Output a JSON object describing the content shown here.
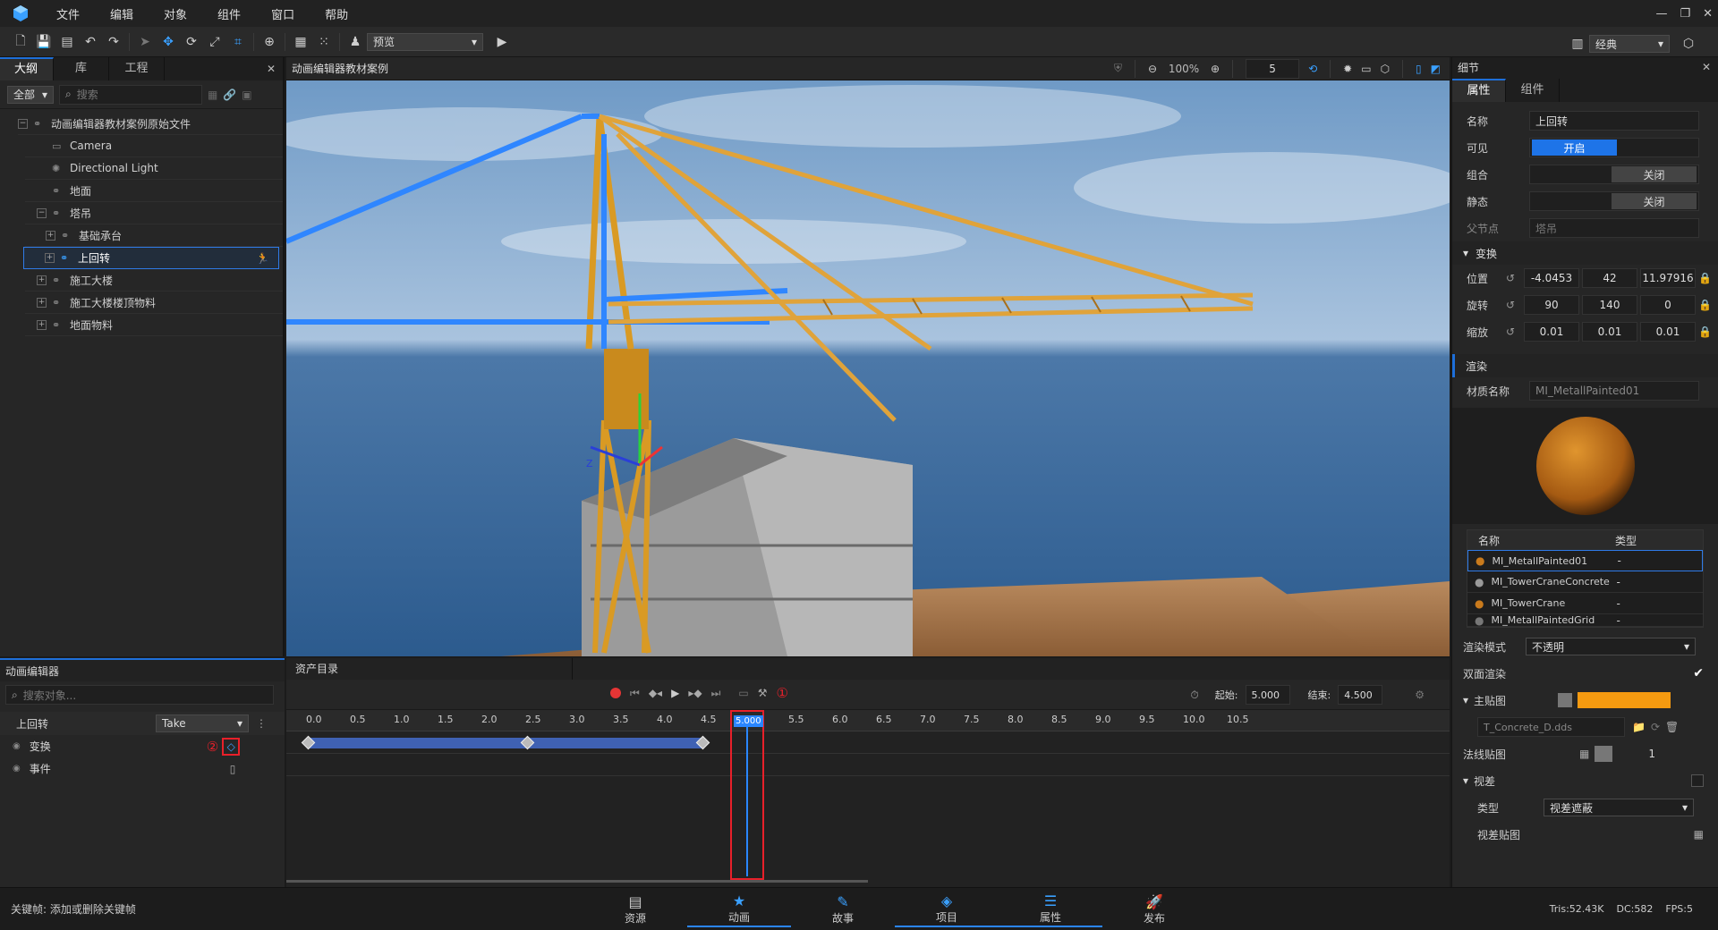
{
  "menu": [
    "文件",
    "编辑",
    "对象",
    "组件",
    "窗口",
    "帮助"
  ],
  "toolbar": {
    "preview_label": "预览",
    "layout_label": "经典"
  },
  "colors": {
    "accent": "#1e6fd9",
    "highlight": "#2a86ff",
    "record": "#e63535",
    "orange": "#f5a623",
    "track": "#3f61b3",
    "red_box": "#e8202a"
  },
  "outline": {
    "tabs": [
      "大纲",
      "库",
      "工程"
    ],
    "filter": "全部",
    "search_placeholder": "搜索",
    "items": [
      {
        "label": "动画编辑器教材案例原始文件",
        "icon": "object-icon"
      },
      {
        "label": "Camera",
        "icon": "camera-icon"
      },
      {
        "label": "Directional Light",
        "icon": "light-icon"
      },
      {
        "label": "地面",
        "icon": "object-icon"
      },
      {
        "label": "塔吊",
        "icon": "object-icon"
      },
      {
        "label": "基础承台",
        "icon": "object-icon"
      },
      {
        "label": "上回转",
        "icon": "object-icon"
      },
      {
        "label": "施工大楼",
        "icon": "object-icon"
      },
      {
        "label": "施工大楼楼顶物料",
        "icon": "object-icon"
      },
      {
        "label": "地面物料",
        "icon": "object-icon"
      }
    ]
  },
  "viewport": {
    "title": "动画编辑器教材案例",
    "zoom": "100%",
    "speed": "5",
    "axis_label": "Z"
  },
  "details": {
    "title": "细节",
    "tabs": [
      "属性",
      "组件"
    ],
    "name_label": "名称",
    "name_value": "上回转",
    "visible_label": "可见",
    "visible_value": "开启",
    "group_label": "组合",
    "group_value": "关闭",
    "static_label": "静态",
    "static_value": "关闭",
    "parent_label": "父节点",
    "parent_value": "塔吊",
    "transform_section": "变换",
    "position_label": "位置",
    "position": [
      "-4.0453",
      "42",
      "11.97916"
    ],
    "rotation_label": "旋转",
    "rotation": [
      "90",
      "140",
      "0"
    ],
    "scale_label": "缩放",
    "scale": [
      "0.01",
      "0.01",
      "0.01"
    ],
    "render_section": "渲染",
    "material_name_label": "材质名称",
    "material_name_value": "MI_MetallPainted01",
    "mat_table_headers": [
      "名称",
      "类型"
    ],
    "materials": [
      {
        "name": "MI_MetallPainted01",
        "type": "-"
      },
      {
        "name": "MI_TowerCraneConcrete",
        "type": "-"
      },
      {
        "name": "MI_TowerCrane",
        "type": "-"
      },
      {
        "name": "MI_MetallPaintedGrid",
        "type": "-"
      }
    ],
    "render_mode_label": "渲染模式",
    "render_mode_value": "不透明",
    "double_side_label": "双面渲染",
    "main_tex_label": "主贴图",
    "main_tex_file": "T_Concrete_D.dds",
    "normal_tex_label": "法线贴图",
    "normal_value": "1",
    "parallax_label": "视差",
    "parallax_type_label": "类型",
    "parallax_type_value": "视差遮蔽",
    "parallax_tex_label": "视差贴图"
  },
  "anim_editor": {
    "title": "动画编辑器",
    "search_placeholder": "搜索对象...",
    "object_name": "上回转",
    "take": "Take",
    "tracks": [
      "变换",
      "事件"
    ],
    "marker1": "①",
    "marker2": "②"
  },
  "assets": {
    "title": "资产目录"
  },
  "timeline": {
    "start_label": "起始:",
    "start_value": "5.000",
    "end_label": "结束:",
    "end_value": "4.500",
    "ticks": [
      "0.0",
      "0.5",
      "1.0",
      "1.5",
      "2.0",
      "2.5",
      "3.0",
      "3.5",
      "4.0",
      "4.5",
      "5.0",
      "5.5",
      "6.0",
      "6.5",
      "7.0",
      "7.5",
      "8.0",
      "8.5",
      "9.0",
      "9.5",
      "10.0",
      "10.5"
    ],
    "playhead": "5.000",
    "keyframes": [
      0.0,
      2.5,
      4.5
    ]
  },
  "status": {
    "hint": "关键帧: 添加或删除关键帧",
    "tris": "Tris:52.43K",
    "dc": "DC:582",
    "fps": "FPS:5"
  },
  "dock": [
    {
      "label": "资源",
      "icon": "assets-icon"
    },
    {
      "label": "动画",
      "icon": "animation-icon"
    },
    {
      "label": "故事",
      "icon": "story-icon"
    },
    {
      "label": "项目",
      "icon": "project-icon"
    },
    {
      "label": "属性",
      "icon": "properties-icon"
    },
    {
      "label": "发布",
      "icon": "publish-icon"
    }
  ]
}
